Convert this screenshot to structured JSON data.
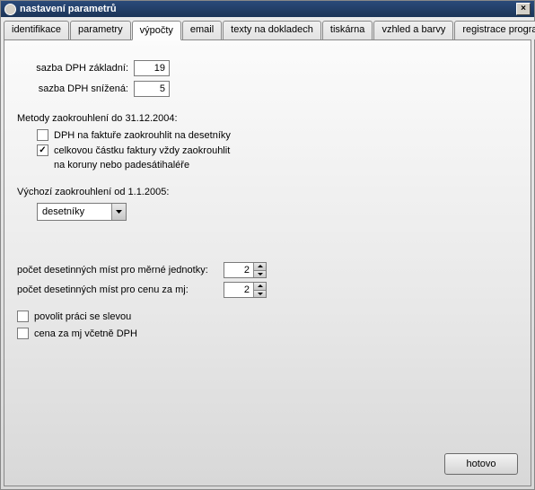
{
  "window": {
    "title": "nastavení parametrů"
  },
  "tabs": [
    {
      "label": "identifikace"
    },
    {
      "label": "parametry"
    },
    {
      "label": "výpočty"
    },
    {
      "label": "email"
    },
    {
      "label": "texty na dokladech"
    },
    {
      "label": "tiskárna"
    },
    {
      "label": "vzhled a barvy"
    },
    {
      "label": "registrace programu"
    }
  ],
  "vat": {
    "base_label": "sazba DPH základní:",
    "base_value": "19",
    "reduced_label": "sazba DPH snížená:",
    "reduced_value": "5"
  },
  "rounding_old": {
    "heading": "Metody zaokrouhlení do 31.12.2004:",
    "opt1_label": "DPH na faktuře zaokrouhlit na desetníky",
    "opt2_label": "celkovou částku faktury vždy zaokrouhlit",
    "opt2_label2": "na koruny nebo padesátihaléře"
  },
  "rounding_new": {
    "heading": "Výchozí zaokrouhlení od 1.1.2005:",
    "selected": "desetníky"
  },
  "decimals": {
    "units_label": "počet desetinných míst pro měrné jednotky:",
    "units_value": "2",
    "price_label": "počet desetinných míst pro cenu za mj:",
    "price_value": "2"
  },
  "options": {
    "discount_label": "povolit práci se slevou",
    "price_vat_label": "cena za mj včetně DPH"
  },
  "buttons": {
    "ok": "hotovo"
  }
}
